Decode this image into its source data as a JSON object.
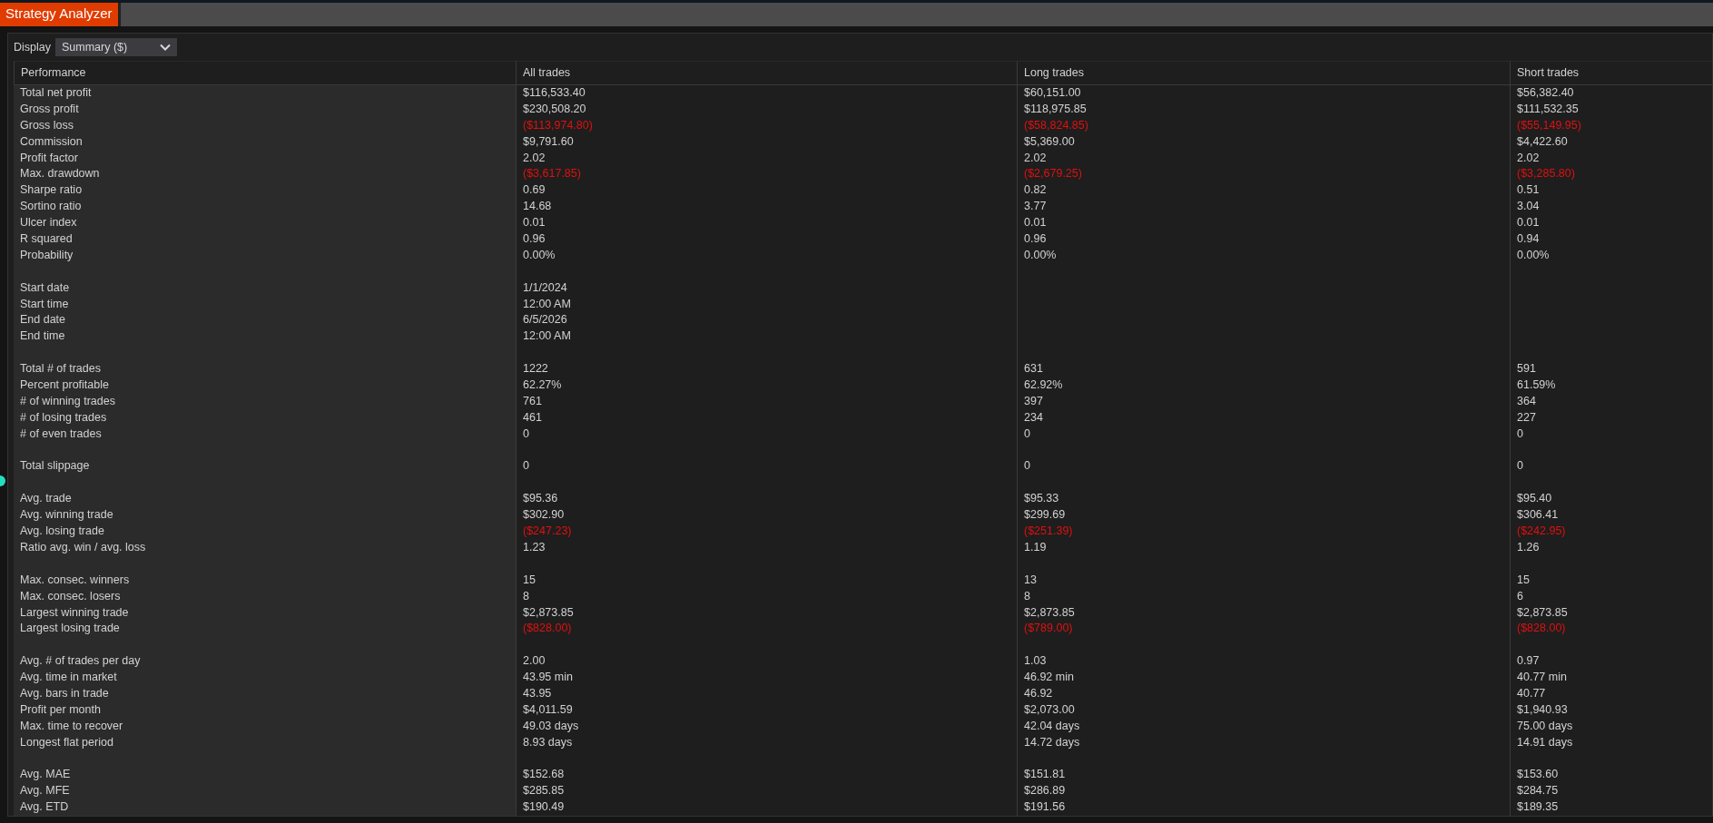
{
  "window": {
    "title": "Strategy Analyzer"
  },
  "display": {
    "label": "Display",
    "value": "Summary ($)"
  },
  "table": {
    "columns": [
      "Performance",
      "All trades",
      "Long trades",
      "Short trades"
    ],
    "rows": [
      {
        "kind": "data",
        "label": "Total net profit",
        "negative": false,
        "cells": [
          "$116,533.40",
          "$60,151.00",
          "$56,382.40"
        ]
      },
      {
        "kind": "data",
        "label": "Gross profit",
        "negative": false,
        "cells": [
          "$230,508.20",
          "$118,975.85",
          "$111,532.35"
        ]
      },
      {
        "kind": "data",
        "label": "Gross loss",
        "negative": true,
        "cells": [
          "($113,974.80)",
          "($58,824.85)",
          "($55,149.95)"
        ]
      },
      {
        "kind": "data",
        "label": "Commission",
        "negative": false,
        "cells": [
          "$9,791.60",
          "$5,369.00",
          "$4,422.60"
        ]
      },
      {
        "kind": "data",
        "label": "Profit factor",
        "negative": false,
        "cells": [
          "2.02",
          "2.02",
          "2.02"
        ]
      },
      {
        "kind": "data",
        "label": "Max. drawdown",
        "negative": true,
        "cells": [
          "($3,617.85)",
          "($2,679.25)",
          "($3,285.80)"
        ]
      },
      {
        "kind": "data",
        "label": "Sharpe ratio",
        "negative": false,
        "cells": [
          "0.69",
          "0.82",
          "0.51"
        ]
      },
      {
        "kind": "data",
        "label": "Sortino ratio",
        "negative": false,
        "cells": [
          "14.68",
          "3.77",
          "3.04"
        ]
      },
      {
        "kind": "data",
        "label": "Ulcer index",
        "negative": false,
        "cells": [
          "0.01",
          "0.01",
          "0.01"
        ]
      },
      {
        "kind": "data",
        "label": "R squared",
        "negative": false,
        "cells": [
          "0.96",
          "0.96",
          "0.94"
        ]
      },
      {
        "kind": "data",
        "label": "Probability",
        "negative": false,
        "cells": [
          "0.00%",
          "0.00%",
          "0.00%"
        ]
      },
      {
        "kind": "spacer"
      },
      {
        "kind": "data",
        "label": "Start date",
        "negative": false,
        "cells": [
          "1/1/2024"
        ]
      },
      {
        "kind": "data",
        "label": "Start time",
        "negative": false,
        "cells": [
          "12:00 AM"
        ]
      },
      {
        "kind": "data",
        "label": "End date",
        "negative": false,
        "cells": [
          "6/5/2026"
        ]
      },
      {
        "kind": "data",
        "label": "End time",
        "negative": false,
        "cells": [
          "12:00 AM"
        ]
      },
      {
        "kind": "spacer"
      },
      {
        "kind": "data",
        "label": "Total # of trades",
        "negative": false,
        "cells": [
          "1222",
          "631",
          "591"
        ]
      },
      {
        "kind": "data",
        "label": "Percent profitable",
        "negative": false,
        "cells": [
          "62.27%",
          "62.92%",
          "61.59%"
        ]
      },
      {
        "kind": "data",
        "label": "# of winning trades",
        "negative": false,
        "cells": [
          "761",
          "397",
          "364"
        ]
      },
      {
        "kind": "data",
        "label": "# of losing trades",
        "negative": false,
        "cells": [
          "461",
          "234",
          "227"
        ]
      },
      {
        "kind": "data",
        "label": "# of even trades",
        "negative": false,
        "cells": [
          "0",
          "0",
          "0"
        ]
      },
      {
        "kind": "spacer"
      },
      {
        "kind": "data",
        "label": "Total slippage",
        "negative": false,
        "cells": [
          "0",
          "0",
          "0"
        ]
      },
      {
        "kind": "spacer"
      },
      {
        "kind": "data",
        "label": "Avg. trade",
        "negative": false,
        "cells": [
          "$95.36",
          "$95.33",
          "$95.40"
        ]
      },
      {
        "kind": "data",
        "label": "Avg. winning trade",
        "negative": false,
        "cells": [
          "$302.90",
          "$299.69",
          "$306.41"
        ]
      },
      {
        "kind": "data",
        "label": "Avg. losing trade",
        "negative": true,
        "cells": [
          "($247.23)",
          "($251.39)",
          "($242.95)"
        ]
      },
      {
        "kind": "data",
        "label": "Ratio avg. win / avg. loss",
        "negative": false,
        "cells": [
          "1.23",
          "1.19",
          "1.26"
        ]
      },
      {
        "kind": "spacer"
      },
      {
        "kind": "data",
        "label": "Max. consec. winners",
        "negative": false,
        "cells": [
          "15",
          "13",
          "15"
        ]
      },
      {
        "kind": "data",
        "label": "Max. consec. losers",
        "negative": false,
        "cells": [
          "8",
          "8",
          "6"
        ]
      },
      {
        "kind": "data",
        "label": "Largest winning trade",
        "negative": false,
        "cells": [
          "$2,873.85",
          "$2,873.85",
          "$2,873.85"
        ]
      },
      {
        "kind": "data",
        "label": "Largest losing trade",
        "negative": true,
        "cells": [
          "($828.00)",
          "($789.00)",
          "($828.00)"
        ]
      },
      {
        "kind": "spacer"
      },
      {
        "kind": "data",
        "label": "Avg. # of trades per day",
        "negative": false,
        "cells": [
          "2.00",
          "1.03",
          "0.97"
        ]
      },
      {
        "kind": "data",
        "label": "Avg. time in market",
        "negative": false,
        "cells": [
          "43.95 min",
          "46.92 min",
          "40.77 min"
        ]
      },
      {
        "kind": "data",
        "label": "Avg. bars in trade",
        "negative": false,
        "cells": [
          "43.95",
          "46.92",
          "40.77"
        ]
      },
      {
        "kind": "data",
        "label": "Profit per month",
        "negative": false,
        "cells": [
          "$4,011.59",
          "$2,073.00",
          "$1,940.93"
        ]
      },
      {
        "kind": "data",
        "label": "Max. time to recover",
        "negative": false,
        "cells": [
          "49.03 days",
          "42.04 days",
          "75.00 days"
        ]
      },
      {
        "kind": "data",
        "label": "Longest flat period",
        "negative": false,
        "cells": [
          "8.93 days",
          "14.72 days",
          "14.91 days"
        ]
      },
      {
        "kind": "spacer"
      },
      {
        "kind": "data",
        "label": "Avg. MAE",
        "negative": false,
        "cells": [
          "$152.68",
          "$151.81",
          "$153.60"
        ]
      },
      {
        "kind": "data",
        "label": "Avg. MFE",
        "negative": false,
        "cells": [
          "$285.85",
          "$286.89",
          "$284.75"
        ]
      },
      {
        "kind": "data",
        "label": "Avg. ETD",
        "negative": false,
        "cells": [
          "$190.49",
          "$191.56",
          "$189.35"
        ]
      }
    ]
  }
}
